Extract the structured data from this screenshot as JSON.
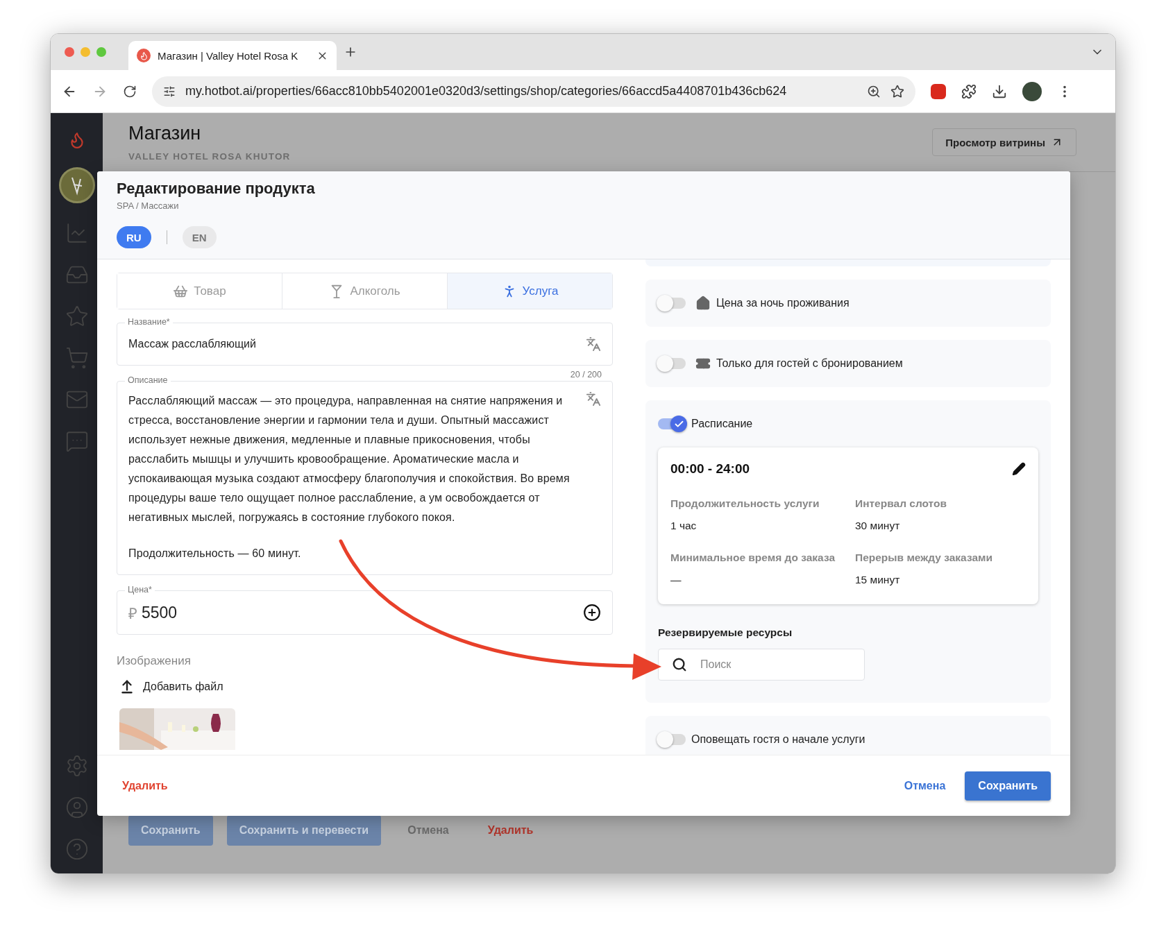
{
  "browser": {
    "tab_title": "Магазин | Valley Hotel Rosa K",
    "url": "my.hotbot.ai/properties/66acc810bb5402001e0320d3/settings/shop/categories/66accd5a4408701b436cb624"
  },
  "page": {
    "title": "Магазин",
    "subtitle": "VALLEY HOTEL ROSA KHUTOR",
    "storefront_button": "Просмотр витрины",
    "actions": [
      {
        "label": "Сохранить",
        "kind": "primary"
      },
      {
        "label": "Сохранить и перевести",
        "kind": "primary"
      },
      {
        "label": "Отмена",
        "kind": "plain"
      },
      {
        "label": "Удалить",
        "kind": "danger"
      }
    ]
  },
  "modal": {
    "title": "Редактирование продукта",
    "breadcrumb": "SPA / Массажи",
    "languages": [
      {
        "label": "RU",
        "selected": true
      },
      {
        "label": "EN",
        "selected": false
      }
    ],
    "type_tabs": [
      {
        "label": "Товар",
        "selected": false
      },
      {
        "label": "Алкоголь",
        "selected": false
      },
      {
        "label": "Услуга",
        "selected": true
      }
    ],
    "name_field": {
      "label": "Название*",
      "value": "Массаж расслабляющий"
    },
    "char_count": "20 / 200",
    "description_field": {
      "label": "Описание",
      "paragraphs": [
        "Расслабляющий массаж — это процедура, направленная на снятие напряжения и стресса, восстановление энергии и гармонии тела и души. Опытный массажист использует нежные движения, медленные и плавные прикосновения, чтобы расслабить мышцы и улучшить кровообращение. Ароматические масла и успокаивающая музыка создают атмосферу благополучия и спокойствия. Во время процедуры ваше тело ощущает полное расслабление, а ум освобождается от негативных мыслей, погружаясь в состояние глубокого покоя.",
        "Продолжительность — 60 минут."
      ]
    },
    "price_field": {
      "label": "Цена*",
      "currency": "₽",
      "value": "5500"
    },
    "images": {
      "label": "Изображения",
      "add_file": "Добавить файл"
    },
    "options": [
      {
        "label": "Цена за ночь проживания",
        "on": false
      },
      {
        "label": "Только для гостей с бронированием",
        "on": false
      }
    ],
    "schedule": {
      "label": "Расписание",
      "on": true,
      "time_range": "00:00 - 24:00",
      "fields": [
        {
          "label": "Продолжительность услуги",
          "value": "1 час"
        },
        {
          "label": "Интервал слотов",
          "value": "30 минут"
        },
        {
          "label": "Минимальное время до заказа",
          "value": "—"
        },
        {
          "label": "Перерыв между заказами",
          "value": "15 минут"
        }
      ],
      "resources_label": "Резервируемые ресурсы",
      "search_placeholder": "Поиск"
    },
    "notify": {
      "label": "Оповещать гостя о начале услуги",
      "on": false
    },
    "footer": {
      "delete": "Удалить",
      "cancel": "Отмена",
      "save": "Сохранить"
    }
  }
}
